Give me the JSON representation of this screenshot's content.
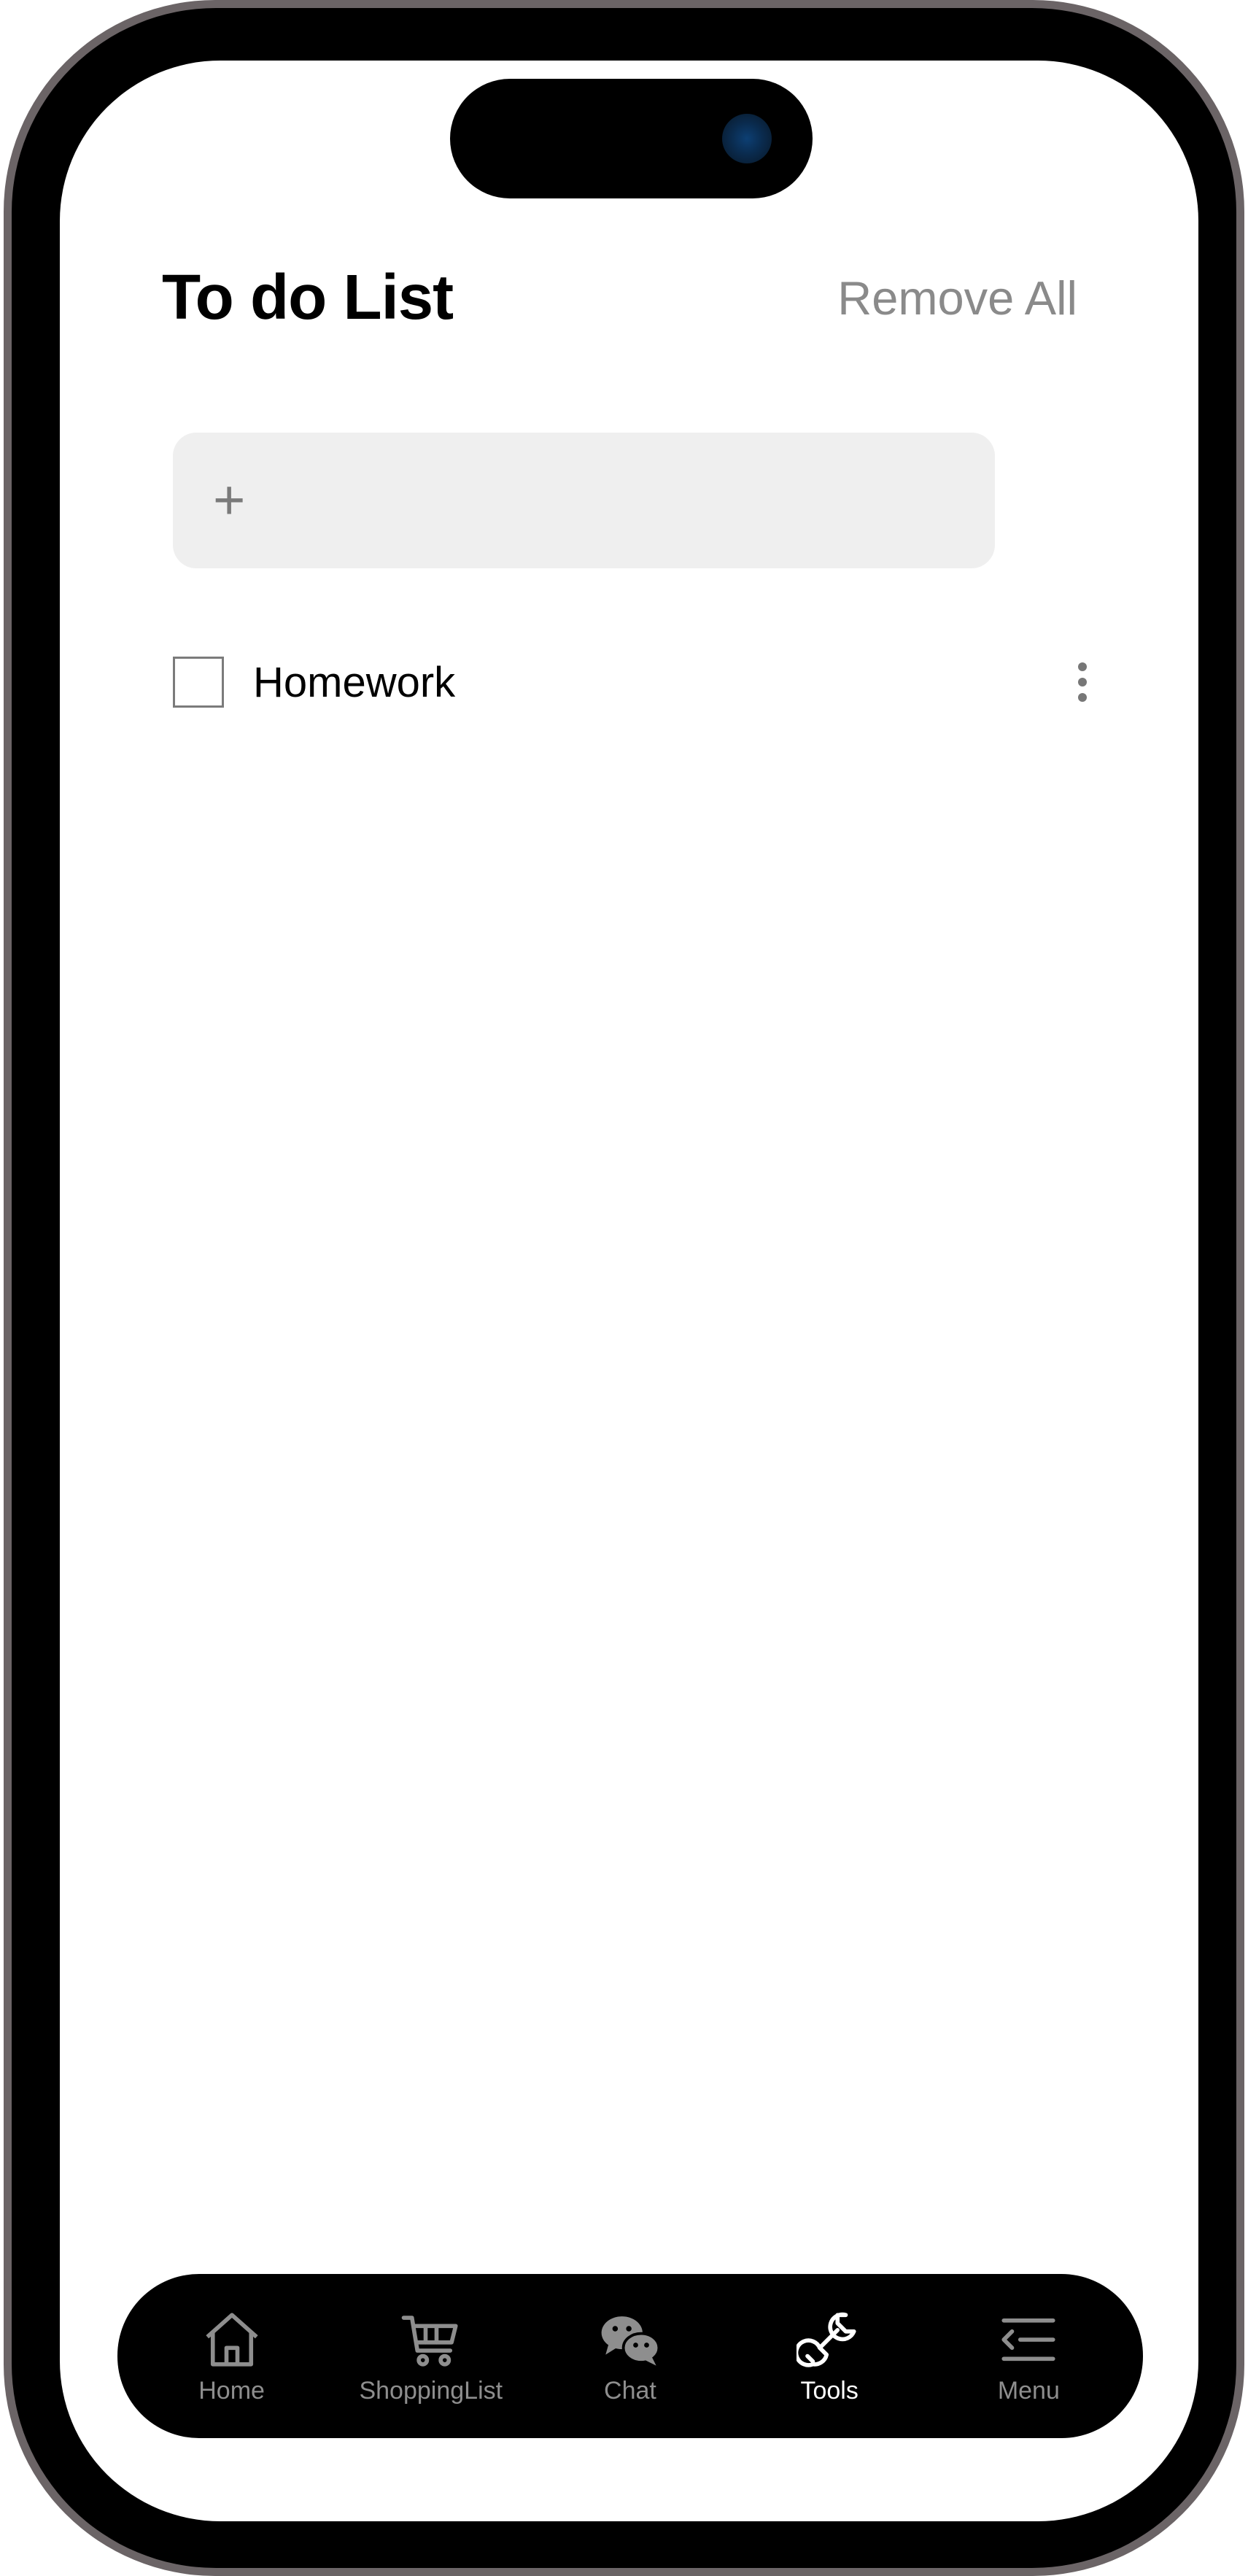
{
  "header": {
    "title": "To do List",
    "remove_all_label": "Remove All"
  },
  "add_bar": {
    "plus": "+",
    "placeholder": ""
  },
  "todos": [
    {
      "label": "Homework",
      "checked": false
    }
  ],
  "tabbar": {
    "active": "tools",
    "tabs": [
      {
        "label": "Home",
        "icon": "home-icon"
      },
      {
        "label": "ShoppingList",
        "icon": "cart-icon"
      },
      {
        "label": "Chat",
        "icon": "chat-icon"
      },
      {
        "label": "Tools",
        "icon": "wrench-icon"
      },
      {
        "label": "Menu",
        "icon": "menu-icon"
      }
    ]
  },
  "colors": {
    "accent_active": "#ffffff",
    "inactive": "#8e8e8e",
    "tabbar_bg": "#000000",
    "input_bg": "#efefef"
  }
}
